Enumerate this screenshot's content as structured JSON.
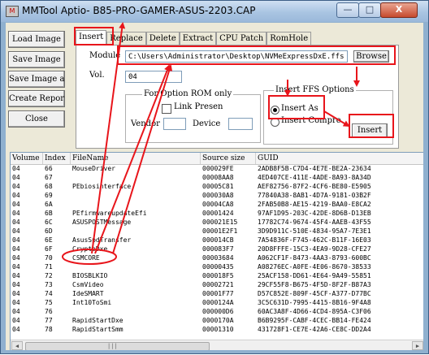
{
  "window": {
    "title": "MMTool Aptio- B85-PRO-GAMER-ASUS-2203.CAP",
    "app_icon": "M",
    "minimize_glyph": "—",
    "maximize_glyph": "□",
    "close_glyph": "X"
  },
  "sidebar": {
    "load_image": "Load Image",
    "save_image": "Save Image",
    "save_image_as": "Save Image as..",
    "create_report": "Create Report",
    "close": "Close"
  },
  "tabs": [
    "Insert",
    "Replace",
    "Delete",
    "Extract",
    "CPU Patch",
    "RomHole"
  ],
  "insert_panel": {
    "module_label": "Module",
    "module_value": "C:\\Users\\Administrator\\Desktop\\NVMeExpressDxE.ffs",
    "browse_label": "Browse",
    "vol_label": "Vol.",
    "vol_value": "04",
    "option_rom_group": "For Option ROM only",
    "link_present_label": "Link Presen",
    "vendor_label": "Vendor",
    "device_label": "Device",
    "ffs_group": "Insert FFS Options",
    "insert_as_label": "Insert As",
    "insert_compressed_label": "Insert Compre",
    "insert_button": "Insert"
  },
  "table": {
    "columns": [
      "Volume",
      "Index",
      "FileName",
      "Source size",
      "GUID"
    ],
    "rows": [
      [
        "04",
        "66",
        "MouseDriver",
        "000029FE",
        "2ADB8F5B-C7D4-4E7E-BE2A-23634"
      ],
      [
        "04",
        "67",
        "",
        "00008AA8",
        "4ED407CE-411E-4ADE-8A93-8A34D"
      ],
      [
        "04",
        "68",
        "PEbiosinterface",
        "00005C81",
        "AEF82756-87F2-4CF6-BE80-E5905"
      ],
      [
        "04",
        "69",
        "",
        "000030A8",
        "77840A38-8AB1-4D7A-9181-03B2F"
      ],
      [
        "04",
        "6A",
        "",
        "00004CA8",
        "2FAB50B8-AE15-4219-BAA0-E8CA2"
      ],
      [
        "04",
        "6B",
        "PEfirmwareupdateEfi",
        "00001424",
        "97AF1D95-203C-42DE-8D6B-D13EB"
      ],
      [
        "04",
        "6C",
        "ASUSPOSTMessage",
        "000021E15",
        "17782C74-9674-45F4-AAEB-43F55"
      ],
      [
        "04",
        "6D",
        "",
        "00001E2F1",
        "3D9D911C-510E-4834-95A7-7E3E1"
      ],
      [
        "04",
        "6E",
        "AsusSpdTransfer",
        "000014CB",
        "7A54836F-F745-462C-B11F-16E03"
      ],
      [
        "04",
        "6F",
        "CryptoDxe",
        "000083F7",
        "20D8FFFE-15C3-4EA9-9D28-CFE27"
      ],
      [
        "04",
        "70",
        "CSMCORE",
        "00003684",
        "A062CF1F-8473-4AA3-8793-600BC"
      ],
      [
        "04",
        "71",
        "",
        "00000435",
        "A08276EC-A0FE-4E06-8670-38533"
      ],
      [
        "04",
        "72",
        "BIOSBLKIO",
        "000018F5",
        "25ACF158-DD61-4E64-9A49-55851"
      ],
      [
        "04",
        "73",
        "CsmVideo",
        "00002721",
        "29CF55F8-B675-4F5D-8F2F-B87A3"
      ],
      [
        "04",
        "74",
        "IdeSMART",
        "00001F77",
        "D57C852E-809F-45CF-A377-D77BC"
      ],
      [
        "04",
        "75",
        "Int10ToSmi",
        "0000124A",
        "3C5C631D-7995-4415-8B16-9F4A8"
      ],
      [
        "04",
        "76",
        "",
        "000000D6",
        "60AC3A8F-4D66-4CD4-895A-C3F06"
      ],
      [
        "04",
        "77",
        "RapidStartDxe",
        "0000170A",
        "B6B9295F-CABF-4CEC-BB14-FE424"
      ],
      [
        "04",
        "78",
        "RapidStartSmm",
        "00001310",
        "431728F1-CE7E-42A6-CE8C-DD2A4"
      ]
    ]
  },
  "accent": {
    "annotation_red": "#e8151b"
  }
}
